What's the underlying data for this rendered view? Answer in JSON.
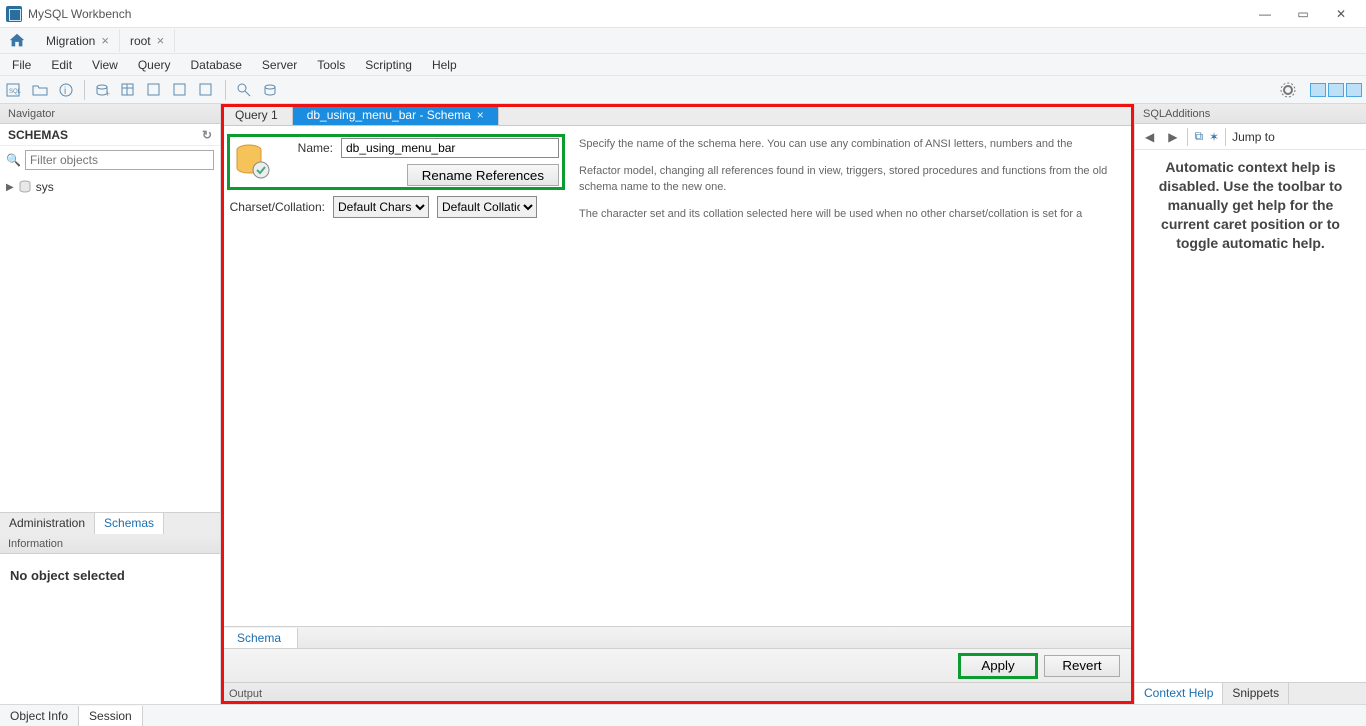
{
  "window": {
    "title": "MySQL Workbench"
  },
  "connection_tabs": [
    {
      "label": "Migration"
    },
    {
      "label": "root"
    }
  ],
  "menu": [
    "File",
    "Edit",
    "View",
    "Query",
    "Database",
    "Server",
    "Tools",
    "Scripting",
    "Help"
  ],
  "navigator": {
    "title": "Navigator",
    "schemas_label": "SCHEMAS",
    "filter_placeholder": "Filter objects",
    "tree_items": [
      "sys"
    ],
    "tabs": {
      "admin": "Administration",
      "schemas": "Schemas"
    },
    "info_title": "Information",
    "info_body": "No object selected"
  },
  "editor": {
    "tabs": [
      {
        "label": "Query 1",
        "active": false
      },
      {
        "label": "db_using_menu_bar - Schema",
        "active": true
      }
    ],
    "name_label": "Name:",
    "name_value": "db_using_menu_bar",
    "rename_btn": "Rename References",
    "charset_label": "Charset/Collation:",
    "charset_value": "Default Charset",
    "collation_value": "Default Collation",
    "desc_name": "Specify the name of the schema here. You can use any combination of ANSI letters, numbers and the",
    "desc_refactor": "Refactor model, changing all references found in view, triggers, stored procedures and functions from the old schema name to the new one.",
    "desc_charset": "The character set and its collation selected here will be used when no other charset/collation is set for a",
    "bottom_tab": "Schema",
    "apply": "Apply",
    "revert": "Revert"
  },
  "additions": {
    "title": "SQLAdditions",
    "jump": "Jump to",
    "help_text": "Automatic context help is disabled. Use the toolbar to manually get help for the current caret position or to toggle automatic help.",
    "tabs": {
      "ctx": "Context Help",
      "snip": "Snippets"
    }
  },
  "output": {
    "title": "Output"
  },
  "status_tabs": {
    "obj": "Object Info",
    "sess": "Session"
  }
}
